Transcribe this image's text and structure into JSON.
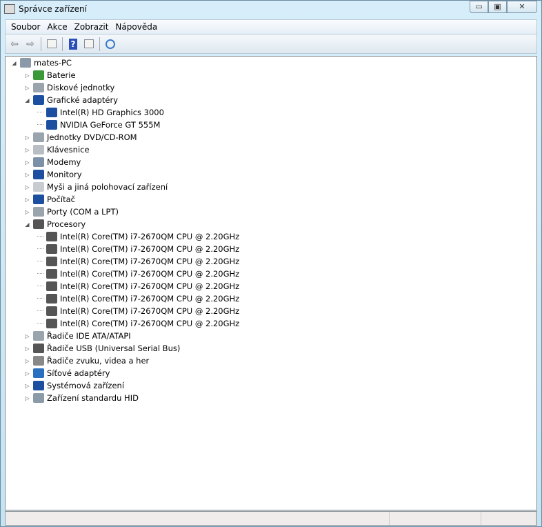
{
  "window": {
    "title": "Správce zařízení",
    "minimize": "▭",
    "maximize": "▣",
    "close": "✕"
  },
  "menu": [
    "Soubor",
    "Akce",
    "Zobrazit",
    "Nápověda"
  ],
  "toolbar": [
    "back-icon",
    "forward-icon",
    "show-hide-console-tree-icon",
    "help-icon",
    "show-action-pane-icon",
    "scan-hardware-changes-icon"
  ],
  "tree": [
    {
      "level": 0,
      "label": "mates-PC",
      "expanded": true,
      "icon": "computer-icon",
      "color": "#8a9aa8"
    },
    {
      "level": 1,
      "label": "Baterie",
      "expanded": false,
      "icon": "battery-icon",
      "color": "#3a9a3a"
    },
    {
      "level": 1,
      "label": "Diskové jednotky",
      "expanded": false,
      "icon": "disk-drive-icon",
      "color": "#9aa4ac"
    },
    {
      "level": 1,
      "label": "Grafické adaptéry",
      "expanded": true,
      "icon": "display-adapter-icon",
      "color": "#1c4fa0"
    },
    {
      "level": 2,
      "label": "Intel(R) HD Graphics 3000",
      "icon": "display-adapter-icon",
      "color": "#1c4fa0"
    },
    {
      "level": 2,
      "label": "NVIDIA GeForce GT 555M",
      "icon": "display-adapter-icon",
      "color": "#1c4fa0"
    },
    {
      "level": 1,
      "label": "Jednotky DVD/CD-ROM",
      "expanded": false,
      "icon": "dvd-drive-icon",
      "color": "#9aa4ac"
    },
    {
      "level": 1,
      "label": "Klávesnice",
      "expanded": false,
      "icon": "keyboard-icon",
      "color": "#b8bec4"
    },
    {
      "level": 1,
      "label": "Modemy",
      "expanded": false,
      "icon": "modem-icon",
      "color": "#7c90a8"
    },
    {
      "level": 1,
      "label": "Monitory",
      "expanded": false,
      "icon": "monitor-icon",
      "color": "#1c4fa0"
    },
    {
      "level": 1,
      "label": "Myši a jiná polohovací zařízení",
      "expanded": false,
      "icon": "mouse-icon",
      "color": "#c8ccd0"
    },
    {
      "level": 1,
      "label": "Počítač",
      "expanded": false,
      "icon": "computer-icon",
      "color": "#1c4fa0"
    },
    {
      "level": 1,
      "label": "Porty (COM a LPT)",
      "expanded": false,
      "icon": "port-icon",
      "color": "#9aa4ac"
    },
    {
      "level": 1,
      "label": "Procesory",
      "expanded": true,
      "icon": "processor-icon",
      "color": "#555"
    },
    {
      "level": 2,
      "label": "Intel(R) Core(TM) i7-2670QM CPU @ 2.20GHz",
      "icon": "processor-icon",
      "color": "#555"
    },
    {
      "level": 2,
      "label": "Intel(R) Core(TM) i7-2670QM CPU @ 2.20GHz",
      "icon": "processor-icon",
      "color": "#555"
    },
    {
      "level": 2,
      "label": "Intel(R) Core(TM) i7-2670QM CPU @ 2.20GHz",
      "icon": "processor-icon",
      "color": "#555"
    },
    {
      "level": 2,
      "label": "Intel(R) Core(TM) i7-2670QM CPU @ 2.20GHz",
      "icon": "processor-icon",
      "color": "#555"
    },
    {
      "level": 2,
      "label": "Intel(R) Core(TM) i7-2670QM CPU @ 2.20GHz",
      "icon": "processor-icon",
      "color": "#555"
    },
    {
      "level": 2,
      "label": "Intel(R) Core(TM) i7-2670QM CPU @ 2.20GHz",
      "icon": "processor-icon",
      "color": "#555"
    },
    {
      "level": 2,
      "label": "Intel(R) Core(TM) i7-2670QM CPU @ 2.20GHz",
      "icon": "processor-icon",
      "color": "#555"
    },
    {
      "level": 2,
      "label": "Intel(R) Core(TM) i7-2670QM CPU @ 2.20GHz",
      "icon": "processor-icon",
      "color": "#555"
    },
    {
      "level": 1,
      "label": "Řadiče IDE ATA/ATAPI",
      "expanded": false,
      "icon": "ide-controller-icon",
      "color": "#9aa4ac"
    },
    {
      "level": 1,
      "label": "Řadiče USB (Universal Serial Bus)",
      "expanded": false,
      "icon": "usb-icon",
      "color": "#555"
    },
    {
      "level": 1,
      "label": "Řadiče zvuku, videa a her",
      "expanded": false,
      "icon": "speaker-icon",
      "color": "#888"
    },
    {
      "level": 1,
      "label": "Síťové adaptéry",
      "expanded": false,
      "icon": "network-adapter-icon",
      "color": "#2a70c0"
    },
    {
      "level": 1,
      "label": "Systémová zařízení",
      "expanded": false,
      "icon": "system-device-icon",
      "color": "#1c4fa0"
    },
    {
      "level": 1,
      "label": "Zařízení standardu HID",
      "expanded": false,
      "icon": "hid-icon",
      "color": "#8a9aa8"
    }
  ]
}
